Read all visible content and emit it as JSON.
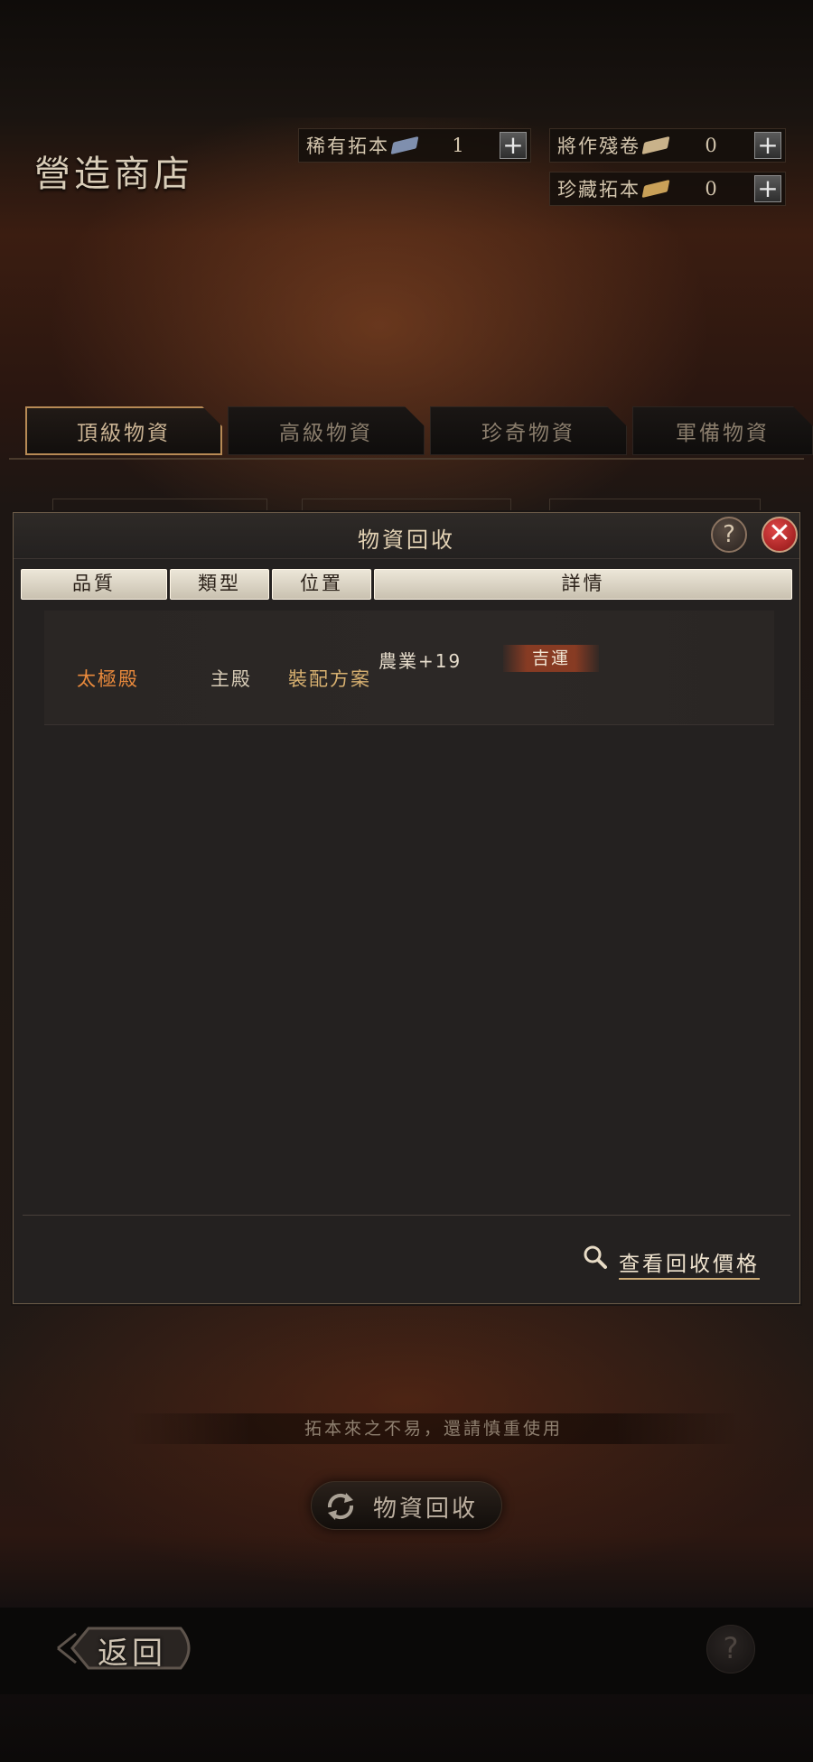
{
  "shop": {
    "title": "營造商店"
  },
  "currencies": [
    {
      "label": "稀有拓本",
      "value": "1",
      "icon": "book-icon",
      "color": "#7f8fae"
    },
    {
      "label": "將作殘卷",
      "value": "0",
      "icon": "scroll-icon",
      "color": "#c9b28a"
    },
    {
      "label": "珍藏拓本",
      "value": "0",
      "icon": "book-icon",
      "color": "#c9a058"
    }
  ],
  "plus_symbol": "+",
  "tabs": [
    "頂級物資",
    "高級物資",
    "珍奇物資",
    "軍備物資"
  ],
  "active_tab": 0,
  "dialog": {
    "title": "物資回收",
    "help_symbol": "?",
    "close_symbol": "✕",
    "columns": [
      "品質",
      "類型",
      "位置",
      "詳情"
    ],
    "rows": [
      {
        "quality": "太極殿",
        "quality_color": "#ea8a3c",
        "type": "主殿",
        "position": "裝配方案",
        "detail": "農業+19",
        "tag": "吉運"
      }
    ],
    "check_price": "查看回收價格"
  },
  "hint": "拓本來之不易，還請慎重使用",
  "recycle_button": "物資回收",
  "back_button": "返回",
  "bottom_help": "?"
}
